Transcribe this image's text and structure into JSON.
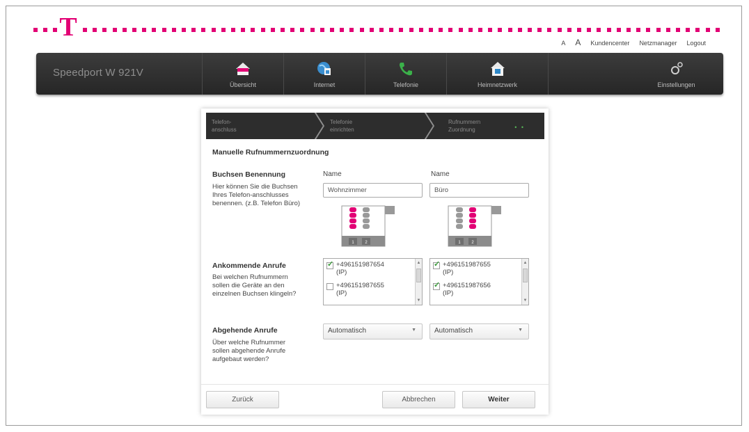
{
  "header": {
    "logo_letter": "T",
    "brand_color": "#e20074",
    "font_small": "A",
    "font_large": "A",
    "links": [
      "Kundencenter",
      "Netzmanager",
      "Logout"
    ]
  },
  "navbar": {
    "brand": "Speedport W 921V",
    "items": [
      {
        "label": "Übersicht",
        "icon": "house-icon"
      },
      {
        "label": "Internet",
        "icon": "globe-icon"
      },
      {
        "label": "Telefonie",
        "icon": "phone-icon"
      },
      {
        "label": "Heimnetzwerk",
        "icon": "home-network-icon"
      },
      {
        "label": "Einstellungen",
        "icon": "settings-icon"
      }
    ]
  },
  "wizard": {
    "steps": [
      {
        "label": "Telefon-\nanschluss"
      },
      {
        "label": "Telefonie\neinrichten"
      },
      {
        "label": "Rufnummern\nZuordnung"
      }
    ],
    "step_marker": "• •",
    "title": "Manuelle Rufnummernzuordnung",
    "sockets": {
      "heading": "Buchsen Benennung",
      "description": "Hier können Sie die Buchsen Ihres Telefon-anschlusses benennen. (z.B. Telefon Büro)",
      "col1_label": "Name",
      "col2_label": "Name",
      "col1_value": "Wohnzimmer",
      "col2_value": "Büro",
      "port_1": "1",
      "port_2": "2"
    },
    "incoming": {
      "heading": "Ankommende Anrufe",
      "description": "Bei welchen Rufnummern sollen die Geräte an den einzelnen Buchsen klingeln?",
      "col1_items": [
        {
          "number": "+496151987654",
          "suffix": "(IP)",
          "checked": true
        },
        {
          "number": "+496151987655",
          "suffix": "(IP)",
          "checked": false
        }
      ],
      "col2_items": [
        {
          "number": "+496151987655",
          "suffix": "(IP)",
          "checked": true
        },
        {
          "number": "+496151987656",
          "suffix": "(IP)",
          "checked": true
        }
      ]
    },
    "outgoing": {
      "heading": "Abgehende Anrufe",
      "description": "Über welche Rufnummer sollen abgehende Anrufe aufgebaut werden?",
      "col1_value": "Automatisch",
      "col2_value": "Automatisch"
    },
    "buttons": {
      "back": "Zurück",
      "cancel": "Abbrechen",
      "next": "Weiter"
    }
  },
  "colors": {
    "magenta": "#e20074",
    "navbar_dark": "#2b2b2b",
    "check_green": "#3a9a3a"
  }
}
